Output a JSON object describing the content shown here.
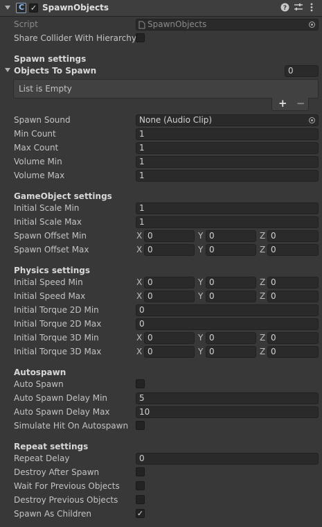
{
  "header": {
    "title": "SpawnObjects",
    "enabled": "✓",
    "help_glyph": "?",
    "preset_glyph": "⇄",
    "menu_glyph": "⋮"
  },
  "script_row": {
    "label": "Script",
    "value": "SpawnObjects"
  },
  "share_collider": {
    "label": "Share Collider With Hierarchy"
  },
  "spawn_settings": {
    "title": "Spawn settings",
    "objects_list": {
      "label": "Objects To Spawn",
      "count": "0",
      "empty_text": "List is Empty",
      "add": "+",
      "remove": "−"
    },
    "spawn_sound": {
      "label": "Spawn Sound",
      "value": "None (Audio Clip)"
    },
    "min_count": {
      "label": "Min Count",
      "value": "1"
    },
    "max_count": {
      "label": "Max Count",
      "value": "1"
    },
    "volume_min": {
      "label": "Volume Min",
      "value": "1"
    },
    "volume_max": {
      "label": "Volume Max",
      "value": "1"
    }
  },
  "gameobject_settings": {
    "title": "GameObject settings",
    "initial_scale_min": {
      "label": "Initial Scale Min",
      "value": "1"
    },
    "initial_scale_max": {
      "label": "Initial Scale Max",
      "value": "1"
    },
    "spawn_offset_min": {
      "label": "Spawn Offset Min",
      "x": "0",
      "y": "0",
      "z": "0"
    },
    "spawn_offset_max": {
      "label": "Spawn Offset Max",
      "x": "0",
      "y": "0",
      "z": "0"
    }
  },
  "physics_settings": {
    "title": "Physics settings",
    "initial_speed_min": {
      "label": "Initial Speed Min",
      "x": "0",
      "y": "0",
      "z": "0"
    },
    "initial_speed_max": {
      "label": "Initial Speed Max",
      "x": "0",
      "y": "0",
      "z": "0"
    },
    "initial_torque_2d_min": {
      "label": "Initial Torque 2D Min",
      "value": "0"
    },
    "initial_torque_2d_max": {
      "label": "Initial Torque 2D Max",
      "value": "0"
    },
    "initial_torque_3d_min": {
      "label": "Initial Torque 3D Min",
      "x": "0",
      "y": "0",
      "z": "0"
    },
    "initial_torque_3d_max": {
      "label": "Initial Torque 3D Max",
      "x": "0",
      "y": "0",
      "z": "0"
    }
  },
  "autospawn": {
    "title": "Autospawn",
    "auto_spawn": {
      "label": "Auto Spawn"
    },
    "delay_min": {
      "label": "Auto Spawn Delay Min",
      "value": "5"
    },
    "delay_max": {
      "label": "Auto Spawn Delay Max",
      "value": "10"
    },
    "simulate_hit": {
      "label": "Simulate Hit On Autospawn"
    }
  },
  "repeat_settings": {
    "title": "Repeat settings",
    "repeat_delay": {
      "label": "Repeat Delay",
      "value": "0"
    },
    "destroy_after_spawn": {
      "label": "Destroy After Spawn"
    },
    "wait_for_previous": {
      "label": "Wait For Previous Objects"
    },
    "destroy_previous": {
      "label": "Destroy Previous Objects"
    },
    "spawn_as_children": {
      "label": "Spawn As Children",
      "check": "✓"
    }
  },
  "axis_labels": {
    "x": "X",
    "y": "Y",
    "z": "Z"
  }
}
